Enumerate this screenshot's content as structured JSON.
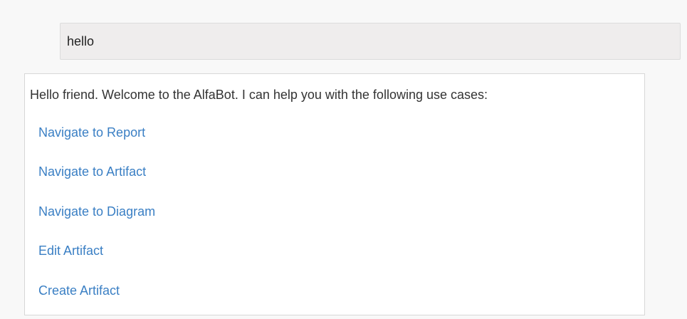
{
  "chat": {
    "user_message": "hello",
    "bot_greeting": "Hello friend. Welcome to the AlfaBot. I can help you with the following use cases:",
    "options": [
      "Navigate to Report",
      "Navigate to Artifact",
      "Navigate to Diagram",
      "Edit Artifact",
      "Create Artifact"
    ]
  },
  "colors": {
    "link": "#3a7fc4",
    "user_bubble_bg": "#efeded",
    "panel_border": "#d7d7d7"
  }
}
